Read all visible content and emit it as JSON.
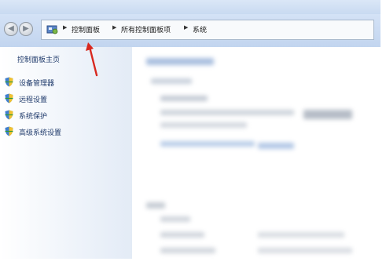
{
  "address_bar": {
    "breadcrumbs": [
      {
        "label": "控制面板"
      },
      {
        "label": "所有控制面板项"
      },
      {
        "label": "系统"
      }
    ]
  },
  "left_pane": {
    "home_link": "控制面板主页",
    "tasks": [
      {
        "label": "设备管理器",
        "icon": "shield-icon"
      },
      {
        "label": "远程设置",
        "icon": "shield-icon"
      },
      {
        "label": "系统保护",
        "icon": "shield-icon"
      },
      {
        "label": "高级系统设置",
        "icon": "shield-icon"
      }
    ]
  },
  "colors": {
    "annotation_arrow": "#d8281f",
    "link_text": "#1f3a6b",
    "toolbar": "#c9daf1"
  }
}
